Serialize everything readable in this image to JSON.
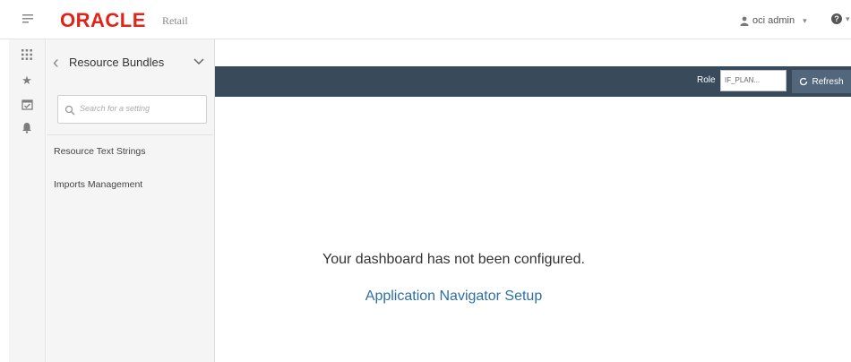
{
  "header": {
    "logo": "ORACLE",
    "logo_suffix": "Retail",
    "user": "oci admin",
    "help_caret": "▾"
  },
  "rail": {
    "icons": [
      "apps-grid-icon",
      "star-icon",
      "calendar-task-icon",
      "bell-icon"
    ]
  },
  "panel": {
    "title": "Resource Bundles",
    "search_placeholder": "Search for a setting",
    "items": [
      {
        "label": "Resource Text Strings"
      },
      {
        "label": "Imports Management"
      }
    ]
  },
  "rolebar": {
    "role_label": "Role",
    "role_value": "IF_PLAN...",
    "refresh_label": "Refresh",
    "color": "#394a5b"
  },
  "main": {
    "message": "Your dashboard has not been configured.",
    "link": "Application Navigator Setup"
  },
  "colors": {
    "brand": "#e2231a",
    "link": "#2e6ea6",
    "rolebar": "#394a5b",
    "button": "#52667c"
  }
}
